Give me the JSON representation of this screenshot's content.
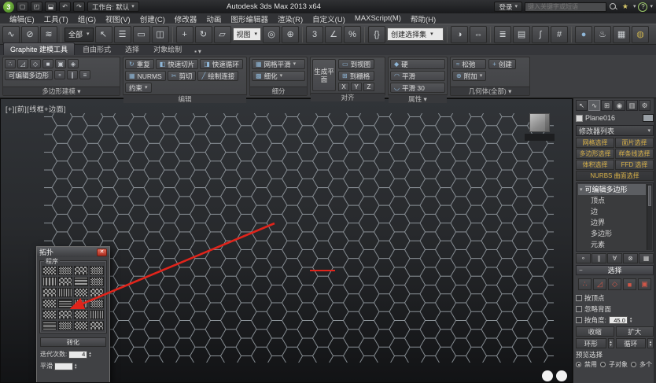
{
  "ui": {
    "caret": "▾",
    "caret_up": "▴",
    "minus": "−"
  },
  "titlebar": {
    "logo_glyph": "3",
    "quick_access": [
      {
        "name": "new-scene",
        "glyph": "▢"
      },
      {
        "name": "open-file",
        "glyph": "◰"
      },
      {
        "name": "save-file",
        "glyph": "⬓"
      },
      {
        "name": "undo",
        "glyph": "↶"
      },
      {
        "name": "redo",
        "glyph": "↷"
      }
    ],
    "workspace": "工作台: 默认",
    "title": "Autodesk 3ds Max 2013 x64",
    "sign_in": "登录",
    "search_placeholder": "键入关键字或短语",
    "star_glyph": "★",
    "help_glyph": "?"
  },
  "menubar": {
    "items": [
      "编辑(E)",
      "工具(T)",
      "组(G)",
      "视图(V)",
      "创建(C)",
      "修改器",
      "动画",
      "图形编辑器",
      "渲染(R)",
      "自定义(U)",
      "MAXScript(M)",
      "帮助(H)"
    ]
  },
  "toolbar": {
    "filter_value": "全部",
    "coord_value": "视图",
    "named_sets_value": "创建选择集",
    "icons": [
      {
        "name": "select-and-link",
        "glyph": "∿"
      },
      {
        "name": "unlink-selection",
        "glyph": "⊘"
      },
      {
        "name": "bind-to-space-warp",
        "glyph": "≋"
      },
      {
        "name": "select-object",
        "glyph": "↖"
      },
      {
        "name": "select-by-name",
        "glyph": "☰"
      },
      {
        "name": "rectangular-selection-region",
        "glyph": "▭"
      },
      {
        "name": "window-crossing",
        "glyph": "◫"
      },
      {
        "name": "select-and-move",
        "glyph": "+"
      },
      {
        "name": "select-and-rotate",
        "glyph": "↻"
      },
      {
        "name": "select-and-scale",
        "glyph": "▱"
      },
      {
        "name": "use-pivot-point-center",
        "glyph": "◎"
      },
      {
        "name": "select-and-manipulate",
        "glyph": "⊕"
      },
      {
        "name": "snaps-toggle-3d",
        "glyph": "3"
      },
      {
        "name": "angle-snap-toggle",
        "glyph": "∠"
      },
      {
        "name": "percent-snap-toggle",
        "glyph": "%"
      },
      {
        "name": "edit-named-selection-sets",
        "glyph": "{}"
      },
      {
        "name": "mirror",
        "glyph": "◑"
      },
      {
        "name": "align",
        "glyph": "⇔"
      },
      {
        "name": "layer-manager",
        "glyph": "≣"
      },
      {
        "name": "ribbon-toggle",
        "glyph": "▤"
      },
      {
        "name": "curve-editor",
        "glyph": "∫"
      },
      {
        "name": "schematic-view",
        "glyph": "#"
      },
      {
        "name": "material-editor",
        "glyph": "●"
      },
      {
        "name": "render-setup",
        "glyph": "♨"
      },
      {
        "name": "rendered-frame-window",
        "glyph": "▦"
      },
      {
        "name": "render-production",
        "glyph": "◍"
      }
    ]
  },
  "ribbon": {
    "tabs": [
      "Graphite 建模工具",
      "自由形式",
      "选择",
      "对象绘制"
    ],
    "poly_panel": {
      "icons_row1": [
        {
          "name": "vertex-mode",
          "glyph": "∴"
        },
        {
          "name": "edge-mode",
          "glyph": "◿"
        },
        {
          "name": "border-mode",
          "glyph": "◇"
        },
        {
          "name": "polygon-mode",
          "glyph": "■"
        },
        {
          "name": "element-mode",
          "glyph": "▣"
        },
        {
          "name": "object-mode",
          "glyph": "◈"
        }
      ],
      "button": "可编辑多边形",
      "icons_row2": [
        {
          "name": "pin-stack",
          "glyph": "⚬"
        },
        {
          "name": "show-end-result",
          "glyph": "∥"
        },
        {
          "name": "collapse-stack",
          "glyph": "≡"
        }
      ],
      "footer": "多边形建模 ▾"
    },
    "edit_panel": {
      "buttons": [
        {
          "glyph": "↻",
          "label": "重复"
        },
        {
          "glyph": "◧",
          "label": "快速切片"
        },
        {
          "glyph": "◨",
          "label": "快速循环"
        },
        {
          "glyph": "▦",
          "label": "NURMS"
        },
        {
          "glyph": "✂",
          "label": "剪切"
        },
        {
          "glyph": "╱",
          "label": "绘制连接"
        }
      ],
      "constraint": "约束",
      "footer": "编辑"
    },
    "subdiv_panel": {
      "buttons": [
        {
          "glyph": "▦",
          "label": "网格平滑"
        },
        {
          "glyph": "▩",
          "label": "细化"
        }
      ],
      "footer": "细分"
    },
    "align_panel": {
      "big": "生成平面",
      "buttons": [
        {
          "glyph": "▭",
          "label": "到视图"
        },
        {
          "glyph": "⊞",
          "label": "到栅格"
        }
      ],
      "axes": [
        "X",
        "Y",
        "Z"
      ],
      "footer": "对齐"
    },
    "props_panel": {
      "buttons": [
        {
          "glyph": "◆",
          "label": "硬"
        },
        {
          "glyph": "◠",
          "label": "平滑"
        },
        {
          "glyph": "◡",
          "label": "平滑 30"
        }
      ],
      "footer": "属性 ▾"
    },
    "geom_panel": {
      "buttons": [
        {
          "glyph": "≈",
          "label": "松弛"
        },
        {
          "glyph": "⊕",
          "label": "附加"
        },
        {
          "glyph": "+",
          "label": "创建"
        }
      ],
      "footer": "几何体(全部) ▾"
    }
  },
  "viewport": {
    "label": "[+][前][线框+边面]"
  },
  "topology": {
    "title": "拓扑",
    "close_glyph": "✕",
    "group": "程序",
    "brick": "砖化",
    "iterations_label": "迭代次数:",
    "iterations_value": "4",
    "smooth_label": "平滑"
  },
  "command_panel": {
    "tabs": [
      {
        "name": "create-tab",
        "glyph": "↖"
      },
      {
        "name": "modify-tab",
        "glyph": "∿"
      },
      {
        "name": "hierarchy-tab",
        "glyph": "⊞"
      },
      {
        "name": "motion-tab",
        "glyph": "◉"
      },
      {
        "name": "display-tab",
        "glyph": "▥"
      },
      {
        "name": "utilities-tab",
        "glyph": "⚙"
      }
    ],
    "object_name": "Plane016",
    "modifier_list_label": "修改器列表",
    "modifier_buttons": [
      "网格选择",
      "面片选择",
      "多边形选择",
      "样条线选择",
      "体积选择",
      "FFD 选择"
    ],
    "modifier_button_wide": "NURBS 曲面选择",
    "stack_root": "可编辑多边形",
    "stack_items": [
      "顶点",
      "边",
      "边界",
      "多边形",
      "元素"
    ],
    "stack_tools": [
      {
        "name": "pin-stack",
        "glyph": "⚬"
      },
      {
        "name": "show-end-result",
        "glyph": "∥"
      },
      {
        "name": "make-unique",
        "glyph": "∀"
      },
      {
        "name": "remove-modifier",
        "glyph": "⊗"
      },
      {
        "name": "configure-modifier-sets",
        "glyph": "▦"
      }
    ],
    "selection": {
      "title": "选择",
      "subobjects": [
        {
          "name": "vertex",
          "glyph": "∴"
        },
        {
          "name": "edge",
          "glyph": "◿"
        },
        {
          "name": "border",
          "glyph": "◇"
        },
        {
          "name": "polygon",
          "glyph": "■"
        },
        {
          "name": "element",
          "glyph": "▣"
        }
      ],
      "by_vertex": "按顶点",
      "ignore_backfacing": "忽略背面",
      "by_angle": "按角度:",
      "angle_value": "45.0",
      "shrink": "收缩",
      "grow": "扩大",
      "ring": "环形",
      "loop": "循环",
      "preview_label": "预览选择",
      "preview_options": [
        "禁用",
        "子对象",
        "多个"
      ]
    }
  },
  "colors": {
    "annotation_red": "#e0241b",
    "hex_line": "#8e959b",
    "accent_yellow": "#d9b249"
  }
}
